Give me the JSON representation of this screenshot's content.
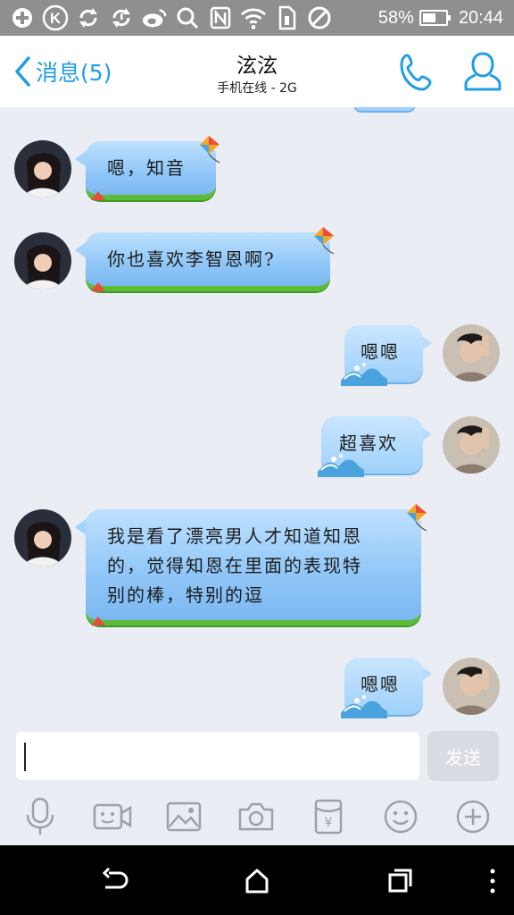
{
  "status_bar": {
    "icons": [
      "plus-circle-icon",
      "k-circle-icon",
      "sync-icon",
      "sync-download-icon",
      "weibo-icon",
      "search-icon",
      "nfc-icon",
      "wifi-icon",
      "sim-icon",
      "blocked-icon"
    ],
    "battery_percent": "58%",
    "battery_level": 0.58,
    "time": "20:44"
  },
  "header": {
    "back_label": "消息(5)",
    "title": "泫泫",
    "subtitle": "手机在线 - 2G",
    "accent_color": "#1f9de6"
  },
  "messages": [
    {
      "side": "left",
      "text": "嗯，知音"
    },
    {
      "side": "left",
      "text": "你也喜欢李智恩啊?"
    },
    {
      "side": "right",
      "text": "嗯嗯"
    },
    {
      "side": "right",
      "text": "超喜欢"
    },
    {
      "side": "left",
      "lines": [
        "我是看了漂亮男人才知道知恩",
        "的，觉得知恩在里面的表现特",
        "别的棒，特别的逗"
      ]
    },
    {
      "side": "right",
      "text": "嗯嗯"
    }
  ],
  "input": {
    "value": "",
    "send_label": "发送"
  },
  "toolbar": [
    "microphone-icon",
    "video-icon",
    "image-icon",
    "camera-icon",
    "red-packet-icon",
    "emoji-icon",
    "plus-icon"
  ],
  "navbar": [
    "back-icon",
    "home-icon",
    "recents-icon",
    "more-icon"
  ]
}
